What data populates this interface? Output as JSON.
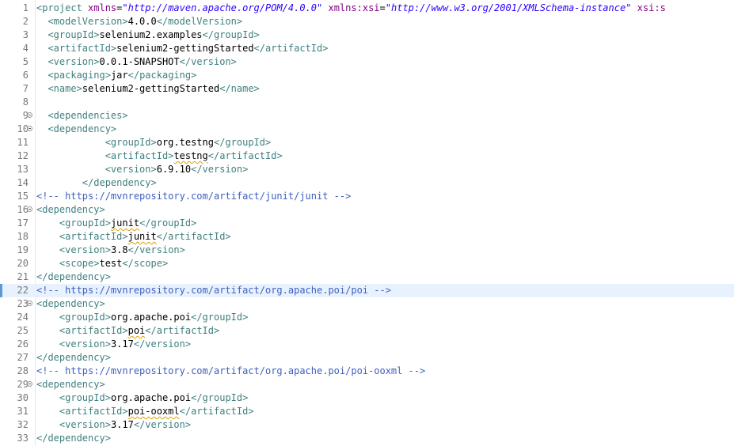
{
  "editor": {
    "current_line": 22,
    "lines": [
      {
        "n": "1",
        "fold": false,
        "indent": "",
        "parts": [
          [
            "t",
            "<project "
          ],
          [
            "a",
            "xmlns"
          ],
          [
            "x",
            "="
          ],
          [
            "v",
            "\"http://maven.apache.org/POM/4.0.0\""
          ],
          [
            "x",
            " "
          ],
          [
            "a",
            "xmlns:xsi"
          ],
          [
            "x",
            "="
          ],
          [
            "v",
            "\"http://www.w3.org/2001/XMLSchema-instance\""
          ],
          [
            "x",
            " "
          ],
          [
            "a",
            "xsi:s"
          ]
        ]
      },
      {
        "n": "2",
        "fold": false,
        "indent": "  ",
        "parts": [
          [
            "t",
            "<modelVersion>"
          ],
          [
            "x",
            "4.0.0"
          ],
          [
            "t",
            "</modelVersion>"
          ]
        ]
      },
      {
        "n": "3",
        "fold": false,
        "indent": "  ",
        "parts": [
          [
            "t",
            "<groupId>"
          ],
          [
            "x",
            "selenium2.examples"
          ],
          [
            "t",
            "</groupId>"
          ]
        ]
      },
      {
        "n": "4",
        "fold": false,
        "indent": "  ",
        "parts": [
          [
            "t",
            "<artifactId>"
          ],
          [
            "x",
            "selenium2-gettingStarted"
          ],
          [
            "t",
            "</artifactId>"
          ]
        ]
      },
      {
        "n": "5",
        "fold": false,
        "indent": "  ",
        "parts": [
          [
            "t",
            "<version>"
          ],
          [
            "x",
            "0.0.1-SNAPSHOT"
          ],
          [
            "t",
            "</version>"
          ]
        ]
      },
      {
        "n": "6",
        "fold": false,
        "indent": "  ",
        "parts": [
          [
            "t",
            "<packaging>"
          ],
          [
            "x",
            "jar"
          ],
          [
            "t",
            "</packaging>"
          ]
        ]
      },
      {
        "n": "7",
        "fold": false,
        "indent": "  ",
        "parts": [
          [
            "t",
            "<name>"
          ],
          [
            "x",
            "selenium2-gettingStarted"
          ],
          [
            "t",
            "</name>"
          ]
        ]
      },
      {
        "n": "8",
        "fold": false,
        "indent": "",
        "parts": []
      },
      {
        "n": "9",
        "fold": true,
        "indent": "  ",
        "parts": [
          [
            "t",
            "<dependencies>"
          ]
        ]
      },
      {
        "n": "10",
        "fold": true,
        "indent": "  ",
        "parts": [
          [
            "t",
            "<dependency>"
          ]
        ]
      },
      {
        "n": "11",
        "fold": false,
        "indent": "            ",
        "parts": [
          [
            "t",
            "<groupId>"
          ],
          [
            "x",
            "org.testng"
          ],
          [
            "t",
            "</groupId>"
          ]
        ]
      },
      {
        "n": "12",
        "fold": false,
        "indent": "            ",
        "parts": [
          [
            "t",
            "<artifactId>"
          ],
          [
            "sq",
            "testng"
          ],
          [
            "t",
            "</artifactId>"
          ]
        ]
      },
      {
        "n": "13",
        "fold": false,
        "indent": "            ",
        "parts": [
          [
            "t",
            "<version>"
          ],
          [
            "x",
            "6.9.10"
          ],
          [
            "t",
            "</version>"
          ]
        ]
      },
      {
        "n": "14",
        "fold": false,
        "indent": "        ",
        "parts": [
          [
            "t",
            "</dependency>"
          ]
        ]
      },
      {
        "n": "15",
        "fold": false,
        "indent": "",
        "parts": [
          [
            "c",
            "<!-- https://mvnrepository.com/artifact/junit/junit -->"
          ]
        ]
      },
      {
        "n": "16",
        "fold": true,
        "indent": "",
        "parts": [
          [
            "t",
            "<dependency>"
          ]
        ]
      },
      {
        "n": "17",
        "fold": false,
        "indent": "    ",
        "parts": [
          [
            "t",
            "<groupId>"
          ],
          [
            "sq",
            "junit"
          ],
          [
            "t",
            "</groupId>"
          ]
        ]
      },
      {
        "n": "18",
        "fold": false,
        "indent": "    ",
        "parts": [
          [
            "t",
            "<artifactId>"
          ],
          [
            "sq",
            "junit"
          ],
          [
            "t",
            "</artifactId>"
          ]
        ]
      },
      {
        "n": "19",
        "fold": false,
        "indent": "    ",
        "parts": [
          [
            "t",
            "<version>"
          ],
          [
            "x",
            "3.8"
          ],
          [
            "t",
            "</version>"
          ]
        ]
      },
      {
        "n": "20",
        "fold": false,
        "indent": "    ",
        "parts": [
          [
            "t",
            "<scope>"
          ],
          [
            "x",
            "test"
          ],
          [
            "t",
            "</scope>"
          ]
        ]
      },
      {
        "n": "21",
        "fold": false,
        "indent": "",
        "parts": [
          [
            "t",
            "</dependency>"
          ]
        ]
      },
      {
        "n": "22",
        "fold": false,
        "indent": "",
        "parts": [
          [
            "c",
            "<!-- https://mvnrepository.com/artifact/org.apache.poi/poi -->"
          ]
        ]
      },
      {
        "n": "23",
        "fold": true,
        "indent": "",
        "parts": [
          [
            "t",
            "<dependency>"
          ]
        ]
      },
      {
        "n": "24",
        "fold": false,
        "indent": "    ",
        "parts": [
          [
            "t",
            "<groupId>"
          ],
          [
            "x",
            "org.apache.poi"
          ],
          [
            "t",
            "</groupId>"
          ]
        ]
      },
      {
        "n": "25",
        "fold": false,
        "indent": "    ",
        "parts": [
          [
            "t",
            "<artifactId>"
          ],
          [
            "sq",
            "poi"
          ],
          [
            "t",
            "</artifactId>"
          ]
        ]
      },
      {
        "n": "26",
        "fold": false,
        "indent": "    ",
        "parts": [
          [
            "t",
            "<version>"
          ],
          [
            "x",
            "3.17"
          ],
          [
            "t",
            "</version>"
          ]
        ]
      },
      {
        "n": "27",
        "fold": false,
        "indent": "",
        "parts": [
          [
            "t",
            "</dependency>"
          ]
        ]
      },
      {
        "n": "28",
        "fold": false,
        "indent": "",
        "parts": [
          [
            "c",
            "<!-- https://mvnrepository.com/artifact/org.apache.poi/poi-ooxml -->"
          ]
        ]
      },
      {
        "n": "29",
        "fold": true,
        "indent": "",
        "parts": [
          [
            "t",
            "<dependency>"
          ]
        ]
      },
      {
        "n": "30",
        "fold": false,
        "indent": "    ",
        "parts": [
          [
            "t",
            "<groupId>"
          ],
          [
            "x",
            "org.apache.poi"
          ],
          [
            "t",
            "</groupId>"
          ]
        ]
      },
      {
        "n": "31",
        "fold": false,
        "indent": "    ",
        "parts": [
          [
            "t",
            "<artifactId>"
          ],
          [
            "sq",
            "poi-ooxml"
          ],
          [
            "t",
            "</artifactId>"
          ]
        ]
      },
      {
        "n": "32",
        "fold": false,
        "indent": "    ",
        "parts": [
          [
            "t",
            "<version>"
          ],
          [
            "x",
            "3.17"
          ],
          [
            "t",
            "</version>"
          ]
        ]
      },
      {
        "n": "33",
        "fold": false,
        "indent": "",
        "parts": [
          [
            "t",
            "</dependency>"
          ]
        ]
      }
    ]
  }
}
